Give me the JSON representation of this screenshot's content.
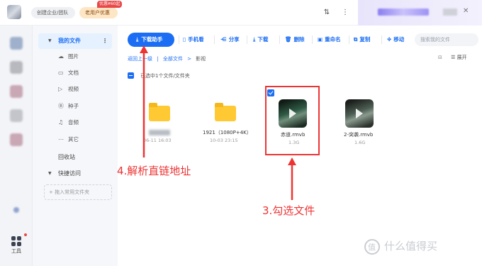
{
  "topbar": {
    "team_label": "创建企业/团队",
    "vip_label": "老用户优惠",
    "promo_badge": "优惠¥60起",
    "sort_icon": "sort-icon",
    "more_icon": "more-vertical-icon"
  },
  "rail": {
    "tools_label": "工具"
  },
  "sidebar": {
    "my_files": "我的文件",
    "items": [
      {
        "icon": "image-icon",
        "glyph": "☁",
        "label": "图片"
      },
      {
        "icon": "doc-icon",
        "glyph": "▭",
        "label": "文档"
      },
      {
        "icon": "video-icon",
        "glyph": "▷",
        "label": "视频"
      },
      {
        "icon": "seed-icon",
        "glyph": "Ⓑ",
        "label": "种子"
      },
      {
        "icon": "audio-icon",
        "glyph": "♫",
        "label": "音频"
      },
      {
        "icon": "other-icon",
        "glyph": "⋯",
        "label": "其它"
      }
    ],
    "recycle": "回收站",
    "quick_access": "快捷访问",
    "add_fav": "+ 拖入常用文件夹"
  },
  "toolbar": {
    "download_helper": "下载助手",
    "phone": "手机看",
    "share": "分享",
    "download": "下载",
    "delete": "删除",
    "rename": "重命名",
    "copy": "复制",
    "move": "移动",
    "search_placeholder": "搜索我的文件"
  },
  "breadcrumb": {
    "back": "返回上一级",
    "all": "全部文件",
    "current": "影视"
  },
  "view": {
    "expand": "展开"
  },
  "selection": {
    "summary": "已选中1个文件/文件夹"
  },
  "files": [
    {
      "name": "",
      "meta": "06-11 16:03",
      "type": "folder"
    },
    {
      "name": "1921（1080P+4K）",
      "meta": "10-03 23:15",
      "type": "folder"
    },
    {
      "name": "赤道.rmvb",
      "meta": "1.3G",
      "type": "video",
      "selected": true
    },
    {
      "name": "2-突袭.rmvb",
      "meta": "1.6G",
      "type": "video"
    }
  ],
  "annotations": {
    "step4": "4.解析直链地址",
    "step3": "3.勾选文件"
  },
  "watermark": "什么值得买",
  "colors": {
    "accent": "#1b6ef3",
    "annotation": "#e33333"
  }
}
